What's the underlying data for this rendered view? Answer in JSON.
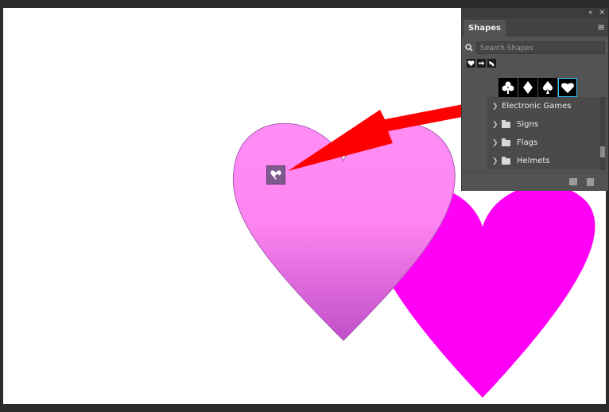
{
  "panel": {
    "title": "Shapes",
    "menu_icon": "≡",
    "collapse_icon": "«",
    "close_icon": "×",
    "search_placeholder": "Search Shapes",
    "recent_icons": [
      "heart-icon",
      "arrow-icon",
      "animal-icon"
    ],
    "tiles": [
      "club-icon",
      "diamond-icon",
      "spade-icon",
      "heart-icon"
    ],
    "selected_tile": "heart-icon",
    "groups": [
      {
        "label": "Electronic Games"
      },
      {
        "label": "Signs"
      },
      {
        "label": "Flags"
      },
      {
        "label": "Helmets"
      }
    ],
    "footer_icons": [
      "new-group-icon",
      "trash-icon"
    ]
  },
  "colors": {
    "heart_light_top": "#ff8df5",
    "heart_light_bottom": "#c04fc8",
    "heart_magenta": "#ff00f6",
    "arrow": "#ff0000",
    "selection": "#36c3ff"
  }
}
